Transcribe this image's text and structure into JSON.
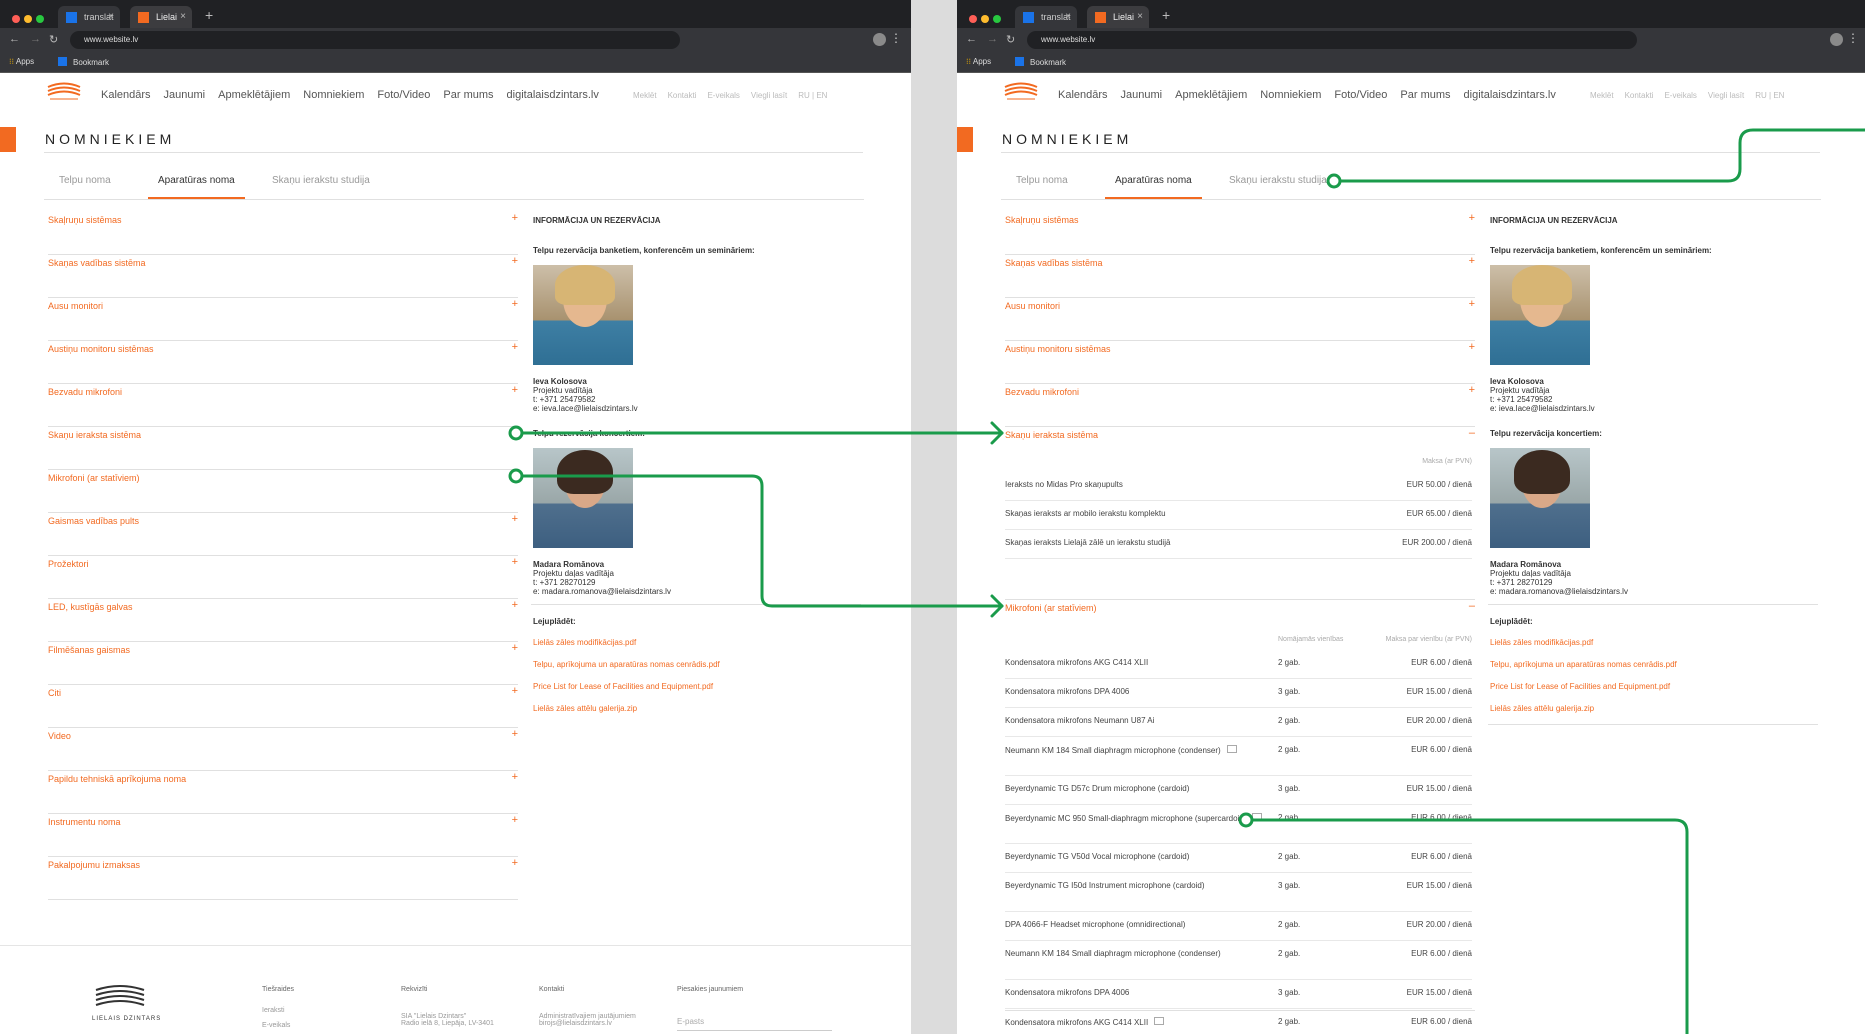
{
  "browser": {
    "tab1": "translat",
    "tab2": "Lielai",
    "new_tab": "+",
    "url": "www.website.lv",
    "apps": "Apps",
    "bookmark": "Bookmark"
  },
  "site": {
    "logo_text": "LIELAIS DZINTARS",
    "nav": [
      "Kalendārs",
      "Jaunumi",
      "Apmeklētājiem",
      "Nomniekiem",
      "Foto/Video",
      "Par mums",
      "digitalaisdzintars.lv"
    ],
    "subnav": [
      "Meklēt",
      "Kontakti",
      "E-veikals",
      "Viegli lasīt",
      "RU | EN"
    ],
    "page_title": "NOMNIEKIEM",
    "tabs": [
      "Telpu noma",
      "Aparatūras noma",
      "Skaņu ierakstu studija"
    ]
  },
  "accordion": [
    "Skaļruņu sistēmas",
    "Skaņas vadības sistēma",
    "Ausu monitori",
    "Austiņu monitoru sistēmas",
    "Bezvadu mikrofoni",
    "Skaņu ieraksta sistēma",
    "Mikrofoni (ar statīviem)",
    "Gaismas vadības pults",
    "Prožektori",
    "LED, kustīgās galvas",
    "Filmēšanas gaismas",
    "Citi",
    "Video",
    "Papildu tehniskā aprīkojuma noma",
    "Instrumentu noma",
    "Pakalpojumu izmaksas"
  ],
  "info": {
    "heading": "INFORMĀCIJA UN REZERVĀCIJA",
    "banquet_label": "Telpu rezervācija banketiem, konferencēm un semināriem:",
    "contact1": {
      "name": "Ieva Kolosova",
      "role": "Projektu vadītāja",
      "phone": "t: +371 25479582",
      "email": "e: ieva.lace@lielaisdzintars.lv"
    },
    "concert_label": "Telpu rezervācija koncertiem:",
    "contact2": {
      "name": "Madara Romānova",
      "role": "Projektu daļas vadītāja",
      "phone": "t: +371 28270129",
      "email": "e: madara.romanova@lielaisdzintars.lv"
    },
    "download_label": "Lejuplādēt:",
    "downloads": [
      "Lielās zāles modifikācijas.pdf",
      "Telpu, aprīkojuma un aparatūras nomas cenrādis.pdf",
      "Price List for Lease of Facilities and Equipment.pdf",
      "Lielās zāles attēlu galerija.zip"
    ]
  },
  "recording": {
    "header": "Maksa (ar PVN)",
    "rows": [
      {
        "name": "Ieraksts no Midas Pro skaņupults",
        "price": "EUR 50.00 / dienā"
      },
      {
        "name": "Skaņas ieraksts ar mobilo ierakstu komplektu",
        "price": "EUR 65.00 / dienā"
      },
      {
        "name": "Skaņas ieraksts Lielajā zālē un ierakstu studijā",
        "price": "EUR 200.00 / dienā"
      }
    ]
  },
  "microphones": {
    "qty_header": "Nomājamās vienības",
    "price_header": "Maksa par vienību (ar PVN)",
    "rows": [
      {
        "name": "Kondensatora mikrofons AKG C414 XLII",
        "qty": "2 gab.",
        "price": "EUR 6.00 / dienā"
      },
      {
        "name": "Kondensatora mikrofons DPA 4006",
        "qty": "3 gab.",
        "price": "EUR 15.00 / dienā"
      },
      {
        "name": "Kondensatora mikrofons Neumann U87 Ai",
        "qty": "2 gab.",
        "price": "EUR 20.00 / dienā"
      },
      {
        "name": "Neumann KM 184 Small diaphragm microphone (condenser)",
        "qty": "2 gab.",
        "price": "EUR 6.00 / dienā"
      },
      {
        "name": "Beyerdynamic TG D57c Drum microphone (cardoid)",
        "qty": "3 gab.",
        "price": "EUR 15.00 / dienā"
      },
      {
        "name": "Beyerdynamic MC 950 Small-diaphragm microphone (supercardoid)",
        "qty": "2 gab.",
        "price": "EUR 6.00 / dienā"
      },
      {
        "name": "Beyerdynamic TG V50d Vocal microphone (cardoid)",
        "qty": "2 gab.",
        "price": "EUR 6.00 / dienā"
      },
      {
        "name": "Beyerdynamic TG I50d Instrument microphone (cardoid)",
        "qty": "3 gab.",
        "price": "EUR 15.00 / dienā"
      },
      {
        "name": "DPA 4066-F Headset microphone (omnidirectional)",
        "qty": "2 gab.",
        "price": "EUR 20.00 / dienā"
      },
      {
        "name": "Neumann KM 184 Small diaphragm microphone (condenser)",
        "qty": "2 gab.",
        "price": "EUR 6.00 / dienā"
      },
      {
        "name": "Kondensatora mikrofons DPA 4006",
        "qty": "3 gab.",
        "price": "EUR 15.00 / dienā"
      },
      {
        "name": "Kondensatora mikrofons AKG C414 XLII",
        "qty": "2 gab.",
        "price": "EUR 6.00 / dienā"
      }
    ]
  },
  "footer": {
    "col1_title": "Tiešraides",
    "col1_items": [
      "Ieraksti",
      "E-veikals"
    ],
    "col2_title": "Rekvizīti",
    "col2_text": "SIA \"Lielais Dzintars\"",
    "col2_text2": "Radio ielā 8, Liepāja, LV-3401",
    "col3_title": "Kontakti",
    "col3_text": "Administratīvajiem jautājumiem",
    "col3_text2": "birojs@lielaisdzintars.lv",
    "col4_title": "Piesakies jaunumiem",
    "col4_placeholder": "E-pasts"
  },
  "colors": {
    "accent": "#f26a21",
    "flow": "#1a9b4b"
  }
}
